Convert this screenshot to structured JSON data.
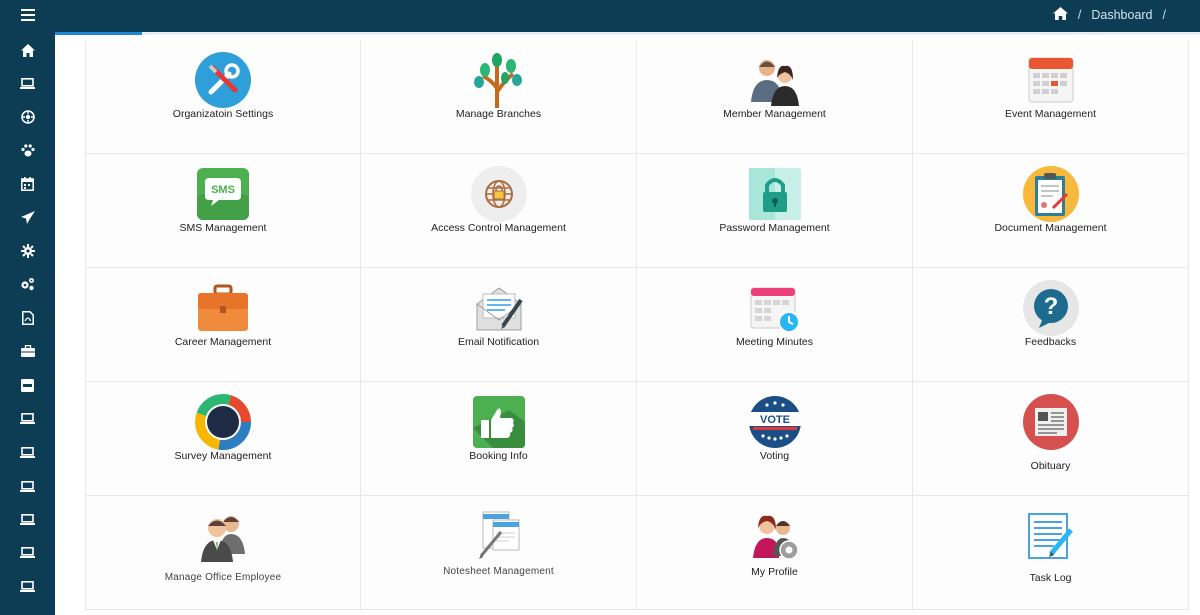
{
  "header": {
    "breadcrumb_home_icon": "home-icon",
    "breadcrumb_sep1": "/",
    "breadcrumb_current": "Dashboard",
    "breadcrumb_sep2": "/"
  },
  "sidebar": {
    "toggle_icon": "hamburger-menu-icon",
    "items": [
      {
        "icon": "home-icon"
      },
      {
        "icon": "laptop-icon"
      },
      {
        "icon": "settings-circle-icon"
      },
      {
        "icon": "paw-icon"
      },
      {
        "icon": "calendar-icon"
      },
      {
        "icon": "send-icon"
      },
      {
        "icon": "gear-icon"
      },
      {
        "icon": "cogs-icon"
      },
      {
        "icon": "pdf-icon"
      },
      {
        "icon": "briefcase-icon"
      },
      {
        "icon": "window-icon"
      },
      {
        "icon": "laptop-icon"
      },
      {
        "icon": "laptop-icon"
      },
      {
        "icon": "laptop-icon"
      },
      {
        "icon": "laptop-icon"
      },
      {
        "icon": "laptop-icon"
      },
      {
        "icon": "laptop-icon"
      }
    ]
  },
  "tiles": [
    {
      "label": "Organizatoin Settings",
      "icon": "tools-icon"
    },
    {
      "label": "Manage Branches",
      "icon": "tree-icon"
    },
    {
      "label": "Member Management",
      "icon": "members-icon"
    },
    {
      "label": "Event Management",
      "icon": "calendar-icon"
    },
    {
      "label": "SMS Management",
      "icon": "sms-icon",
      "icon_text": "SMS"
    },
    {
      "label": "Access Control Management",
      "icon": "access-control-icon"
    },
    {
      "label": "Password Management",
      "icon": "lock-icon"
    },
    {
      "label": "Document Management",
      "icon": "clipboard-icon"
    },
    {
      "label": "Career Management",
      "icon": "briefcase-icon"
    },
    {
      "label": "Email Notification",
      "icon": "email-icon"
    },
    {
      "label": "Meeting Minutes",
      "icon": "meeting-calendar-icon"
    },
    {
      "label": "Feedbacks",
      "icon": "question-icon"
    },
    {
      "label": "Survey Management",
      "icon": "donut-chart-icon"
    },
    {
      "label": "Booking Info",
      "icon": "thumbs-up-icon"
    },
    {
      "label": "Voting",
      "icon": "vote-badge-icon",
      "icon_text": "VOTE"
    },
    {
      "label": "Obituary",
      "icon": "newspaper-icon"
    },
    {
      "label": "Manage Office Employee",
      "icon": "employees-icon"
    },
    {
      "label": "Notesheet Management",
      "icon": "notesheet-icon"
    },
    {
      "label": "My Profile",
      "icon": "profile-icon"
    },
    {
      "label": "Task Log",
      "icon": "task-log-icon"
    }
  ],
  "colors": {
    "sidebar_bg": "#0c3d55",
    "accent": "#1e88d6"
  }
}
